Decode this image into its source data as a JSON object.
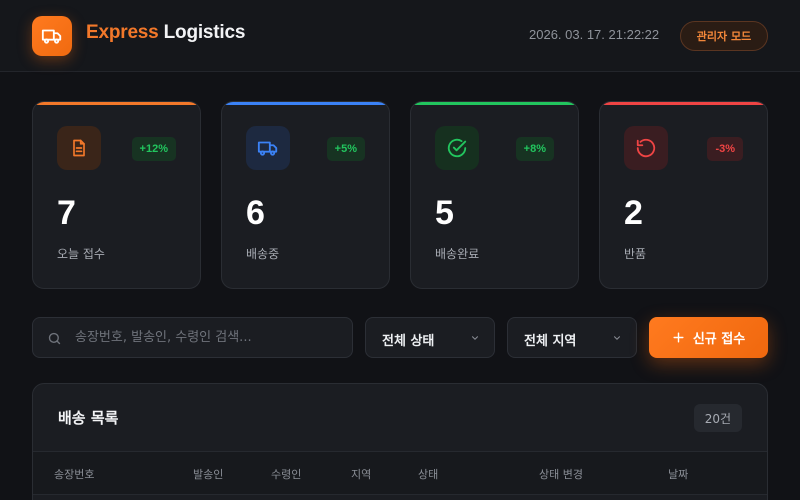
{
  "header": {
    "brand_accent": "Express",
    "brand_rest": " Logistics",
    "datetime": "2026. 03. 17. 21:22:22",
    "admin_label": "관리자 모드",
    "logo_icon": "truck-icon"
  },
  "stats": [
    {
      "value": "7",
      "label": "오늘 접수",
      "change": "+12%",
      "icon": "document-icon",
      "color": "#f2782a",
      "trend": "up"
    },
    {
      "value": "6",
      "label": "배송중",
      "change": "+5%",
      "icon": "truck-icon",
      "color": "#3b82f6",
      "trend": "up"
    },
    {
      "value": "5",
      "label": "배송완료",
      "change": "+8%",
      "icon": "check-circle-icon",
      "color": "#22c55e",
      "trend": "up"
    },
    {
      "value": "2",
      "label": "반품",
      "change": "-3%",
      "icon": "return-icon",
      "color": "#ef4444",
      "trend": "down"
    }
  ],
  "toolbar": {
    "search_placeholder": "송장번호, 발송인, 수령인 검색...",
    "status_filter": "전체 상태",
    "region_filter": "전체 지역",
    "new_label": "신규 접수"
  },
  "table": {
    "title": "배송 목록",
    "count": "20건",
    "columns": [
      "송장번호",
      "발송인",
      "수령인",
      "지역",
      "상태",
      "상태 변경",
      "날짜"
    ]
  },
  "colors": {
    "accent": "#f2782a",
    "positive": "#22c55e",
    "negative": "#ef4444",
    "background": "#111216"
  }
}
